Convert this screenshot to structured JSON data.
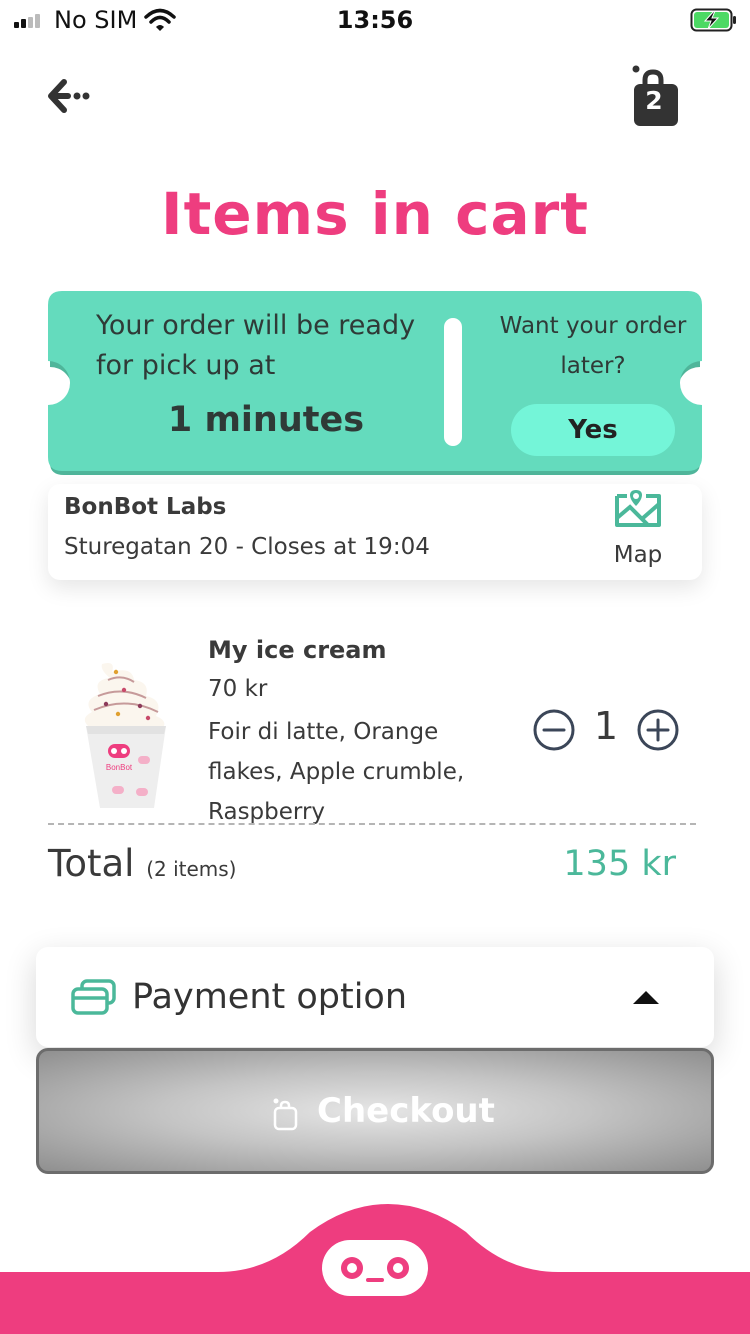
{
  "status_bar": {
    "carrier": "No SIM",
    "time": "13:56"
  },
  "header": {
    "title": "Items in cart",
    "cart_count": "2"
  },
  "pickup": {
    "ready_text": "Your order will be ready for pick up at",
    "ready_time": "1 minutes",
    "later_question": "Want your order later?",
    "yes_label": "Yes"
  },
  "store": {
    "name": "BonBot Labs",
    "address": "Sturegatan 20 - Closes at 19:04",
    "map_label": "Map"
  },
  "cart": {
    "items": [
      {
        "name": "My ice cream",
        "price": "70 kr",
        "options": "Foir di latte, Orange flakes, Apple crumble, Raspberry",
        "quantity": "1",
        "cup_brand": "BonBot"
      }
    ],
    "total_label": "Total",
    "total_count": "(2 items)",
    "total_price": "135 kr"
  },
  "payment": {
    "label": "Payment option"
  },
  "checkout": {
    "label": "Checkout"
  },
  "colors": {
    "brand_pink": "#ee3d7f",
    "ticket_teal": "#64dbbd",
    "yes_button": "#74f5d8",
    "price_teal": "#4bb89a"
  }
}
